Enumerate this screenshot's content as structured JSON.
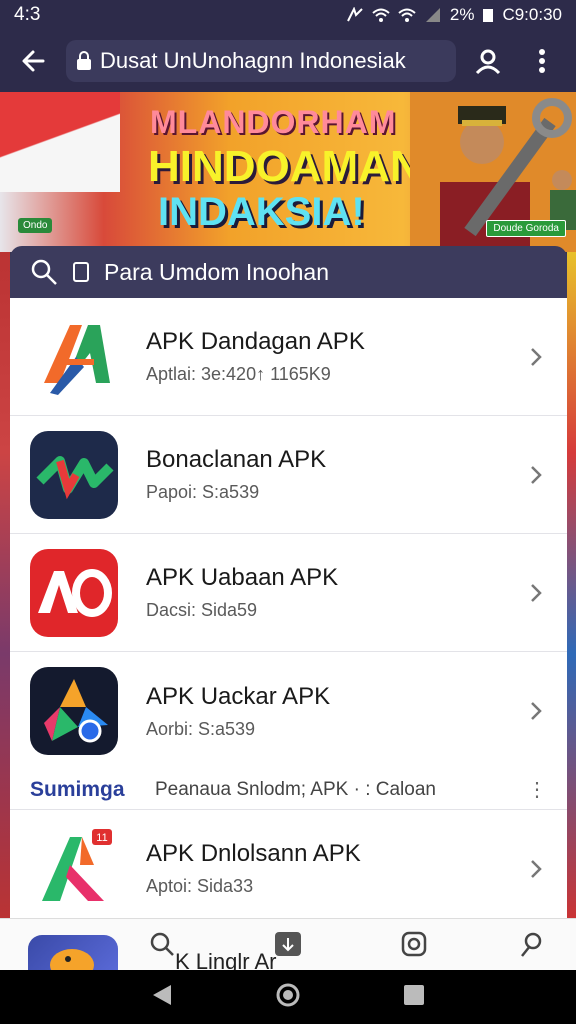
{
  "status_bar": {
    "time": "4:3",
    "battery_text": "2%",
    "clock_right": "C9:0:30"
  },
  "browser": {
    "url_text": "Dusat UnUnohagnn Indonesiak"
  },
  "banner": {
    "line1": "MLANDORHAM",
    "line2": "HINDOAMAN",
    "line3": "INDAKSIA!",
    "badge_left": "Ondo",
    "badge_right": "Doude Goroda"
  },
  "search": {
    "label": "Para Umdom Inoohan"
  },
  "apps": [
    {
      "title": "APK Dandagan APK",
      "subtitle": "Aptlai: 3e:420↑ 1165K9",
      "icon": "green-orange-a-icon"
    },
    {
      "title": "Bonaclanan APK",
      "subtitle": "Papoi: S:a539",
      "icon": "dark-navy-n-icon"
    },
    {
      "title": "APK Uabaan APK",
      "subtitle": "Dacsi: Sida59",
      "icon": "red-ao-icon"
    },
    {
      "title": "APK Uackar APK",
      "subtitle": "Aorbi: S:a539",
      "icon": "colorful-star-icon"
    }
  ],
  "promo": {
    "brand": "Sumimga",
    "text": "Peanaua Snlodm; APK · : Caloan"
  },
  "apps_after": [
    {
      "title": "APK Dnlolsann APK",
      "subtitle": "Aptoi: Sida33",
      "icon": "green-red-a-icon",
      "badge": "11"
    }
  ],
  "bottom_nav": {
    "partial_text": "K Linglr Ar"
  },
  "colors": {
    "header_bg": "#2d2b4a",
    "search_bg": "#3c3b5d",
    "promo_brand": "#2a3f9a"
  }
}
